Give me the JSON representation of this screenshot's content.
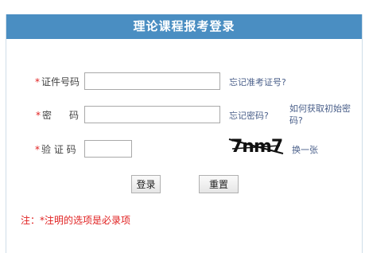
{
  "header": {
    "title": "理论课程报考登录"
  },
  "form": {
    "id_label": "证件号码",
    "password_label_1": "密",
    "password_label_2": "码",
    "captcha_label": "验 证 码",
    "required_mark": "*",
    "captcha_text": "7nm7"
  },
  "links": {
    "forgot_id": "忘记准考证号?",
    "forgot_password": "忘记密码?",
    "get_initial_password_line1": "如何获取初始密",
    "get_initial_password_line2": "码?",
    "refresh_captcha": "换一张"
  },
  "buttons": {
    "login": "登录",
    "reset": "重置"
  },
  "note": "注：*注明的选项是必录项",
  "colors": {
    "header_bg": "#4a8ec2",
    "required": "#e02020",
    "link": "#4a5f8a"
  }
}
